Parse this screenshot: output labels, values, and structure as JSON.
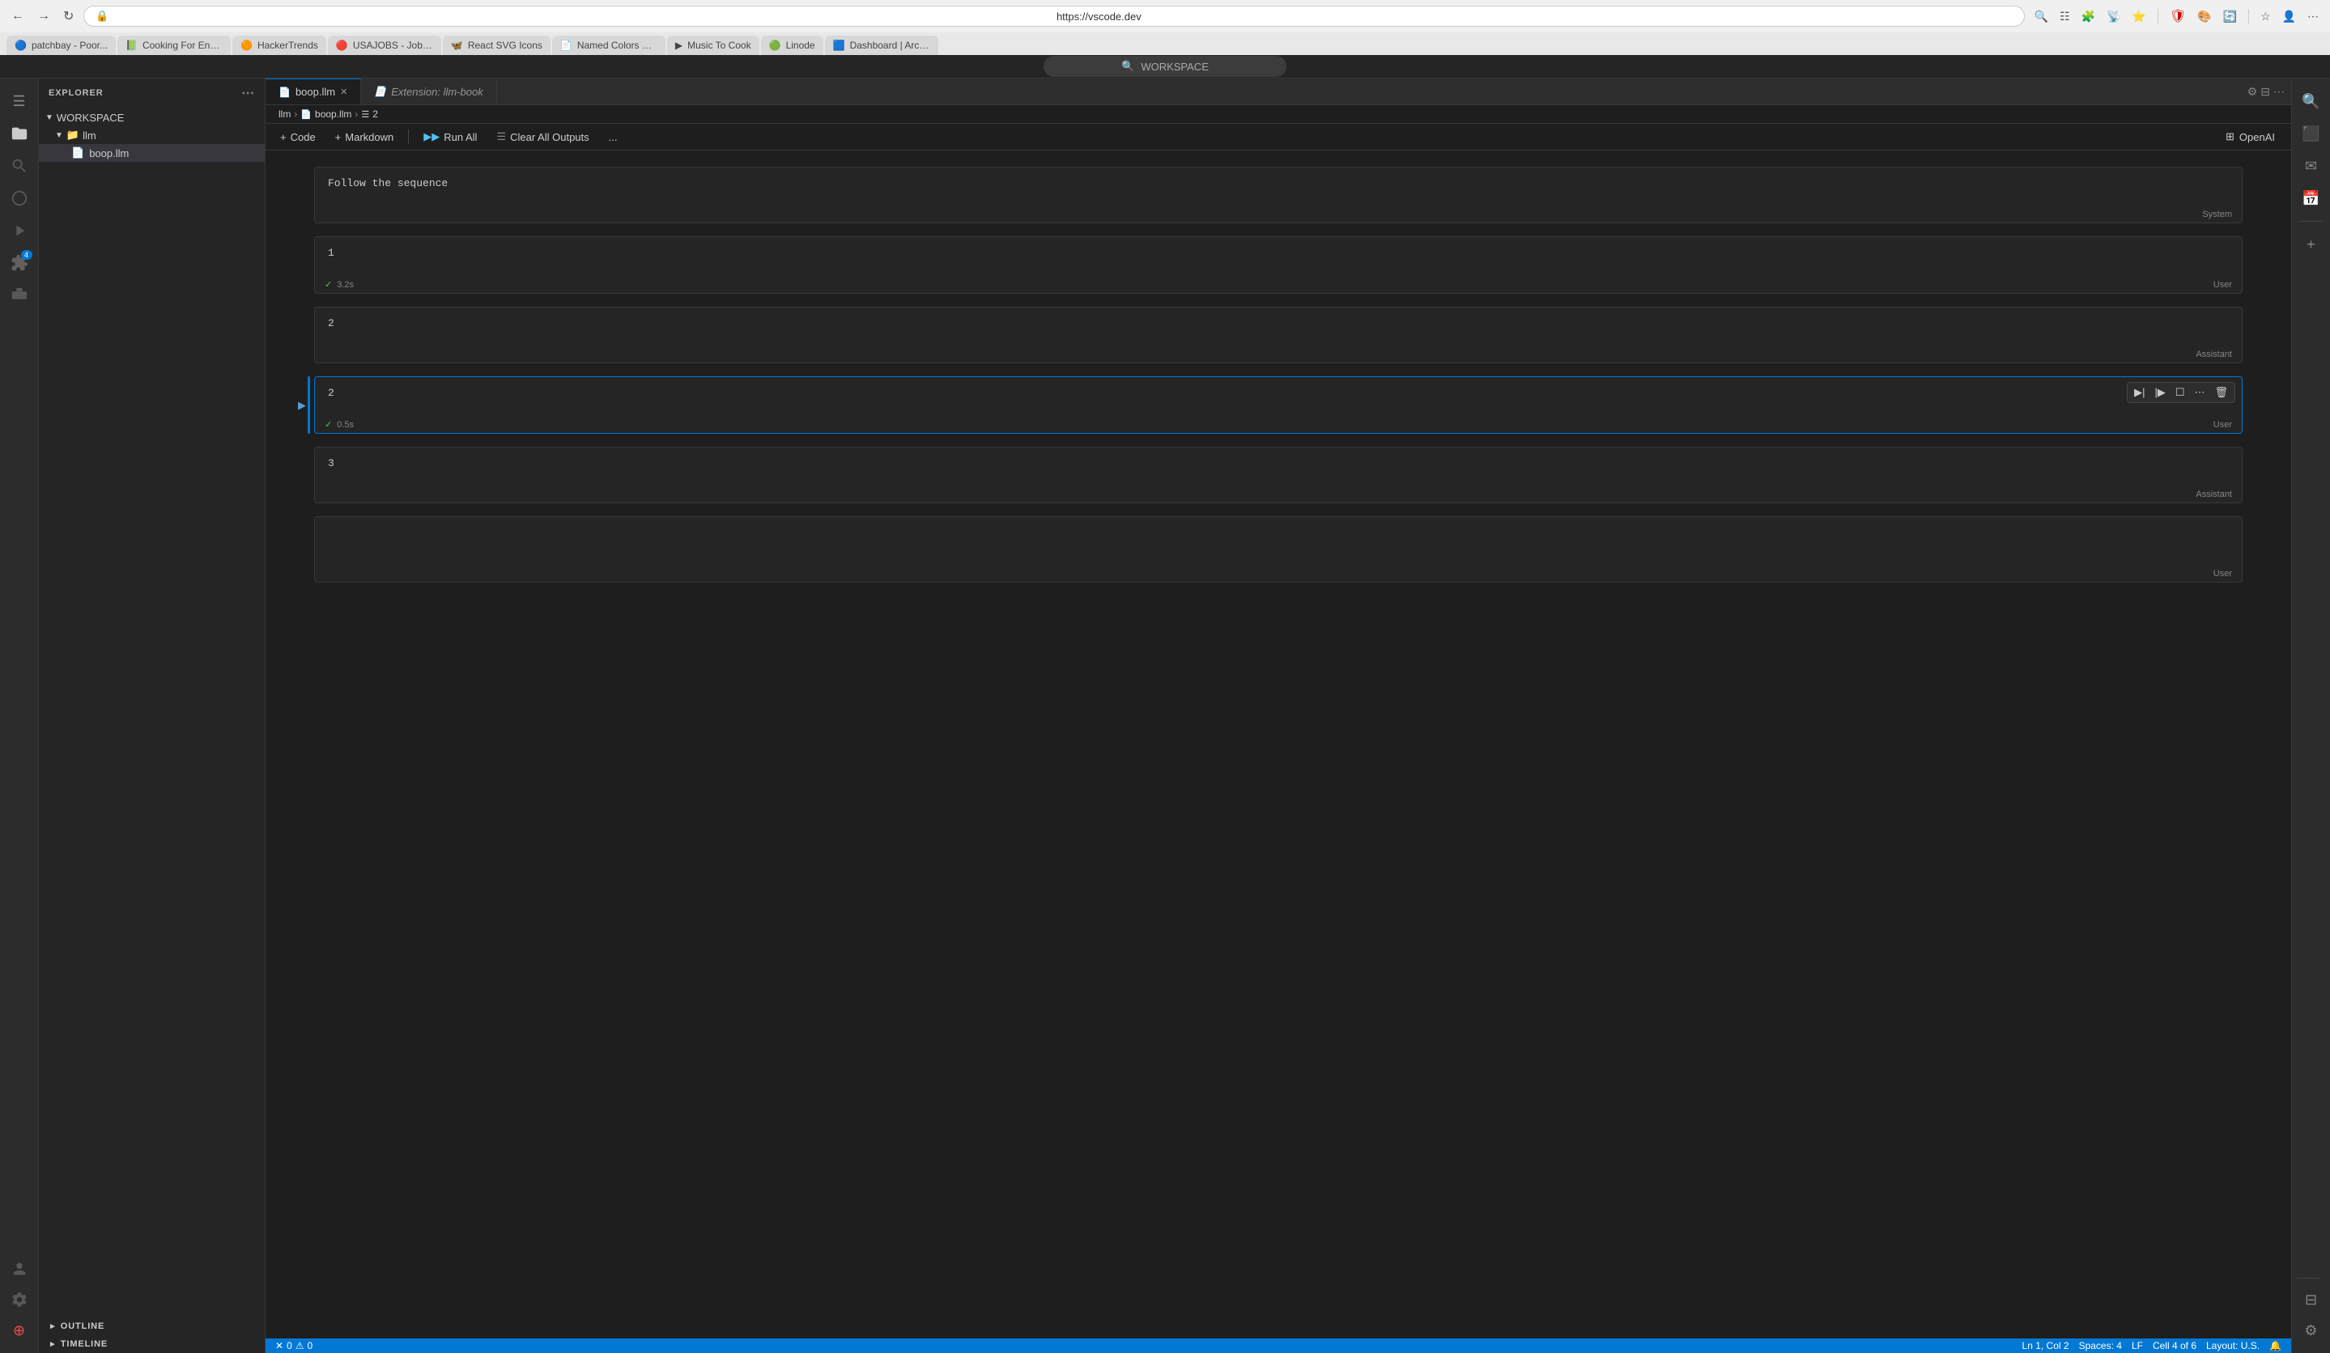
{
  "browser": {
    "address": "https://vscode.dev",
    "tabs": [
      {
        "id": "patchbay",
        "favicon": "🔵",
        "label": "patchbay - Poor..."
      },
      {
        "id": "cooking",
        "favicon": "🟢",
        "label": "Cooking For Engin..."
      },
      {
        "id": "hackertreands",
        "favicon": "🟠",
        "label": "HackerTrends"
      },
      {
        "id": "usajobs",
        "favicon": "🔴",
        "label": "USAJOBS - Job A..."
      },
      {
        "id": "reactsvg",
        "favicon": "🦋",
        "label": "React SVG Icons"
      },
      {
        "id": "namedcolors",
        "favicon": "📄",
        "label": "Named Colors Wh..."
      },
      {
        "id": "musictocook",
        "favicon": "▶",
        "label": "Music To Cook"
      },
      {
        "id": "linode",
        "favicon": "🟢",
        "label": "Linode"
      },
      {
        "id": "dashboard",
        "favicon": "🟦",
        "label": "Dashboard | ArcGl..."
      }
    ]
  },
  "vscode": {
    "workspace_header": "EXPLORER",
    "workspace_name": "WORKSPACE",
    "folder_name": "llm",
    "file_name": "boop.llm",
    "tabs": [
      {
        "id": "boop",
        "label": "boop.llm",
        "active": true,
        "closeable": true
      },
      {
        "id": "extension",
        "label": "Extension: llm-book",
        "active": false,
        "closeable": false
      }
    ],
    "breadcrumbs": [
      "llm",
      "boop.llm",
      "2"
    ],
    "toolbar": {
      "code_label": "Code",
      "markdown_label": "Markdown",
      "run_all_label": "Run All",
      "clear_label": "Clear All Outputs",
      "more_label": "...",
      "openai_label": "OpenAI"
    },
    "cells": [
      {
        "id": "cell-system",
        "content": "Follow the sequence",
        "role": "System",
        "has_check": false,
        "time": null,
        "number": null
      },
      {
        "id": "cell-user-1",
        "content": "1",
        "role": "User",
        "has_check": true,
        "time": "3.2s",
        "number": null
      },
      {
        "id": "cell-assistant-1",
        "content": "2",
        "role": "Assistant",
        "has_check": false,
        "time": null,
        "number": null
      },
      {
        "id": "cell-user-2",
        "content": "2",
        "role": "User",
        "has_check": true,
        "time": "0.5s",
        "number": null,
        "selected": true,
        "has_actions": true
      },
      {
        "id": "cell-assistant-2",
        "content": "3",
        "role": "Assistant",
        "has_check": false,
        "time": null,
        "number": null
      },
      {
        "id": "cell-user-3",
        "content": "",
        "role": "User",
        "has_check": false,
        "time": null,
        "number": null
      }
    ],
    "status_bar": {
      "errors": "0",
      "warnings": "0",
      "position": "Ln 1, Col 2",
      "spaces": "Spaces: 4",
      "encoding": "LF",
      "cell_info": "Cell 4 of 6",
      "layout": "Layout: U.S."
    },
    "sidebar": {
      "outline_label": "OUTLINE",
      "timeline_label": "TIMELINE"
    }
  }
}
